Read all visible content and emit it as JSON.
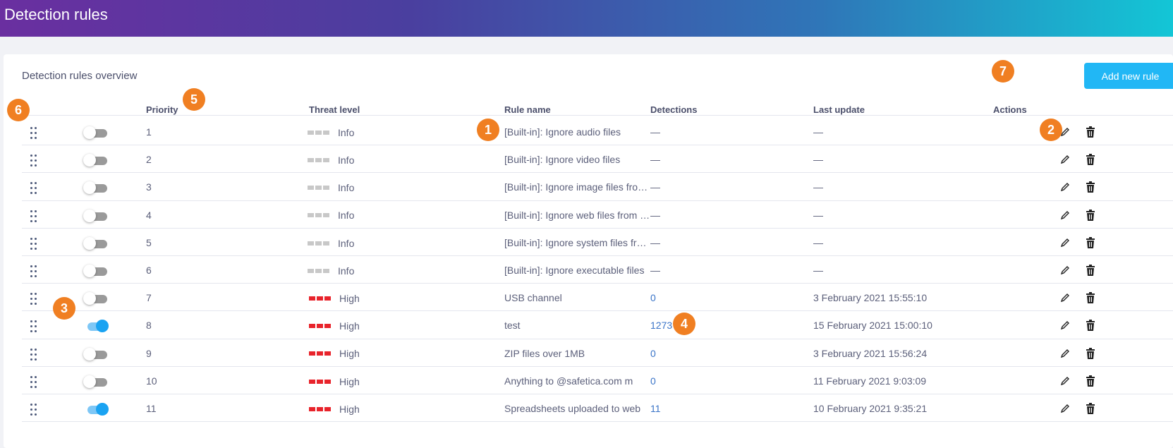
{
  "header": {
    "title": "Detection rules"
  },
  "card": {
    "title": "Detection rules overview",
    "add_button": "Add new rule"
  },
  "columns": {
    "priority": "Priority",
    "threat": "Threat level",
    "rule_name": "Rule name",
    "detections": "Detections",
    "last_update": "Last update",
    "actions": "Actions"
  },
  "badges": [
    "1",
    "2",
    "3",
    "4",
    "5",
    "6",
    "7"
  ],
  "colors": {
    "accent": "#21b7f5",
    "badge": "#f07f22",
    "threat_high": "#e8232b",
    "threat_info": "#c8c8c8"
  },
  "rows": [
    {
      "enabled": false,
      "priority": "1",
      "threat": "Info",
      "name": "[Built-in]: Ignore audio files",
      "detections": "—",
      "last_update": "—"
    },
    {
      "enabled": false,
      "priority": "2",
      "threat": "Info",
      "name": "[Built-in]: Ignore video files",
      "detections": "—",
      "last_update": "—"
    },
    {
      "enabled": false,
      "priority": "3",
      "threat": "Info",
      "name": "[Built-in]: Ignore image files fro…",
      "detections": "—",
      "last_update": "—"
    },
    {
      "enabled": false,
      "priority": "4",
      "threat": "Info",
      "name": "[Built-in]: Ignore web files from …",
      "detections": "—",
      "last_update": "—"
    },
    {
      "enabled": false,
      "priority": "5",
      "threat": "Info",
      "name": "[Built-in]: Ignore system files fr…",
      "detections": "—",
      "last_update": "—"
    },
    {
      "enabled": false,
      "priority": "6",
      "threat": "Info",
      "name": "[Built-in]: Ignore executable files",
      "detections": "—",
      "last_update": "—"
    },
    {
      "enabled": false,
      "priority": "7",
      "threat": "High",
      "name": "USB channel",
      "detections": "0",
      "last_update": "3 February 2021 15:55:10"
    },
    {
      "enabled": true,
      "priority": "8",
      "threat": "High",
      "name": "test",
      "detections": "1273",
      "last_update": "15 February 2021 15:00:10"
    },
    {
      "enabled": false,
      "priority": "9",
      "threat": "High",
      "name": "ZIP files over 1MB",
      "detections": "0",
      "last_update": "3 February 2021 15:56:24"
    },
    {
      "enabled": false,
      "priority": "10",
      "threat": "High",
      "name": "Anything to @safetica.com m",
      "detections": "0",
      "last_update": "11 February 2021 9:03:09"
    },
    {
      "enabled": true,
      "priority": "11",
      "threat": "High",
      "name": "Spreadsheets uploaded to web",
      "detections": "11",
      "last_update": "10 February 2021 9:35:21"
    }
  ]
}
